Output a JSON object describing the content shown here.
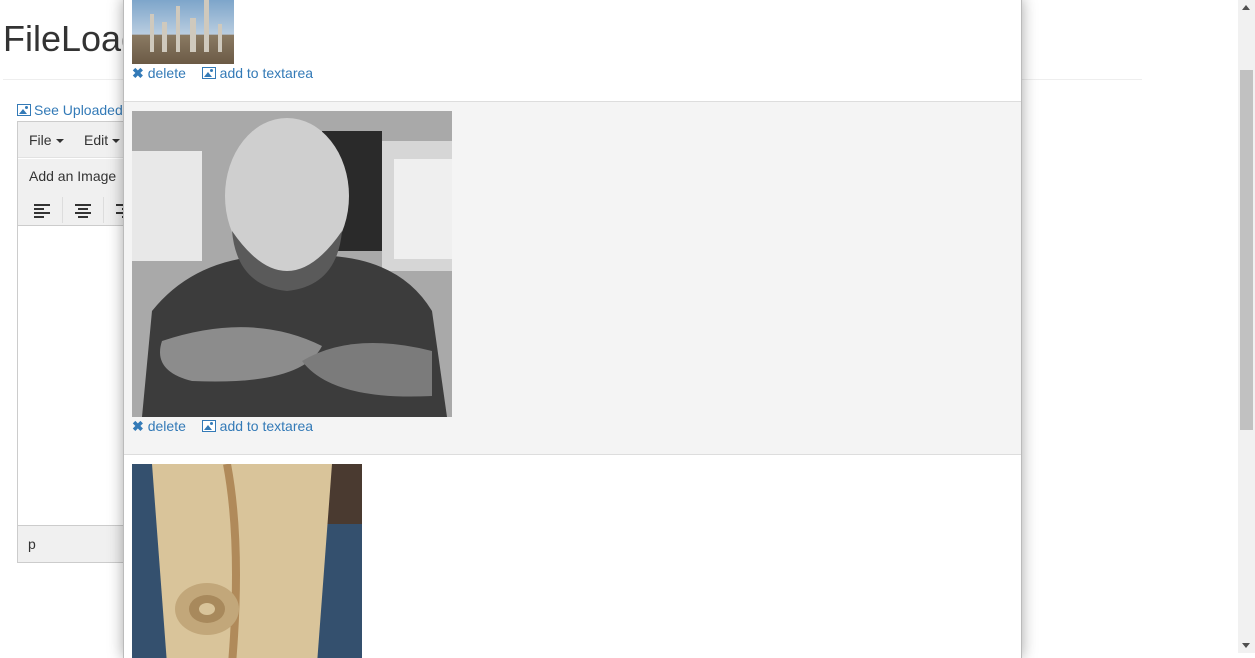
{
  "page": {
    "title": "FileLoad",
    "see_uploaded": "See Uploaded"
  },
  "editor": {
    "menu": [
      {
        "label": "File"
      },
      {
        "label": "Edit"
      }
    ],
    "toolbar": {
      "add_image": "Add an Image"
    },
    "statusbar": {
      "path": "p"
    }
  },
  "modal": {
    "items": [
      {
        "delete_label": "delete",
        "add_label": "add to textarea",
        "image": "factory-photo"
      },
      {
        "delete_label": "delete",
        "add_label": "add to textarea",
        "image": "person-photo"
      },
      {
        "image": "wood-photo"
      }
    ]
  },
  "colors": {
    "link": "#337ab7",
    "alt_row": "#f4f4f4"
  }
}
